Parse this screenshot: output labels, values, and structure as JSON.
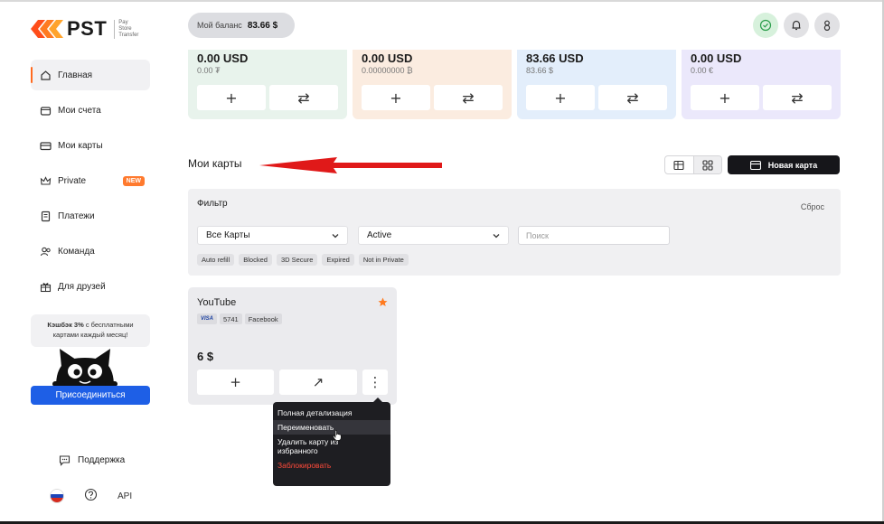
{
  "logo": {
    "brand": "PST",
    "sub": [
      "Pay",
      "Store",
      "Transfer"
    ]
  },
  "nav": {
    "items": [
      {
        "label": "Главная",
        "icon": "home-icon",
        "active": true
      },
      {
        "label": "Мои счета",
        "icon": "wallet-icon"
      },
      {
        "label": "Мои карты",
        "icon": "card-icon"
      },
      {
        "label": "Private",
        "icon": "crown-icon",
        "badge": "NEW"
      },
      {
        "label": "Платежи",
        "icon": "receipt-icon"
      },
      {
        "label": "Команда",
        "icon": "team-icon"
      },
      {
        "label": "Для друзей",
        "icon": "gift-icon"
      }
    ]
  },
  "promo": {
    "bold": "Кэшбэк 3%",
    "text1": " с бесплатными",
    "text2": "картами каждый месяц!",
    "button": "Присоединиться"
  },
  "support": {
    "label": "Поддержка"
  },
  "footer": {
    "api": "API"
  },
  "header": {
    "balance_label": "Мой баланс",
    "balance_value": "83.66 $"
  },
  "accounts": [
    {
      "amount": "0.00 USD",
      "sub": "0.00 ₮",
      "bg": "#e8f3ec"
    },
    {
      "amount": "0.00 USD",
      "sub": "0.00000000 ₿",
      "bg": "#fbece0"
    },
    {
      "amount": "83.66 USD",
      "sub": "83.66 $",
      "bg": "#e3eefb"
    },
    {
      "amount": "0.00 USD",
      "sub": "0.00 €",
      "bg": "#ebe8fb"
    }
  ],
  "cards_section": {
    "title": "Мои карты",
    "new_card": "Новая карта"
  },
  "filter": {
    "title": "Фильтр",
    "reset": "Сброс",
    "type_value": "Все Карты",
    "status_value": "Active",
    "search_placeholder": "Поиск",
    "chips": [
      "Auto refill",
      "Blocked",
      "3D Secure",
      "Expired",
      "Not in Private"
    ]
  },
  "card": {
    "name": "YouTube",
    "brand": "VISA",
    "last4": "5741",
    "tag": "Facebook",
    "amount": "6 $"
  },
  "context_menu": {
    "items": [
      "Полная детализация",
      "Переименовать",
      "Удалить карту из",
      "избранного",
      "Заблокировать"
    ]
  },
  "colors": {
    "accent": "#ff6a1f",
    "primary": "#1e5fe6",
    "danger": "#ff4a3a",
    "arrow": "#e01919"
  }
}
